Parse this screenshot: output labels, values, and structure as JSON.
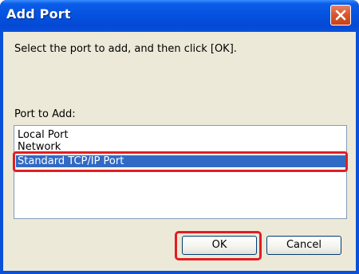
{
  "window": {
    "title": "Add Port"
  },
  "dialog": {
    "prompt": "Select the port to add, and then click [OK].",
    "list_label": "Port to Add:",
    "ports": [
      {
        "label": "Local Port",
        "selected": false
      },
      {
        "label": "Network",
        "selected": false
      },
      {
        "label": "Standard TCP/IP Port",
        "selected": true
      }
    ],
    "ok_label": "OK",
    "cancel_label": "Cancel"
  },
  "colors": {
    "titlebar": "#0553e0",
    "selection": "#316ac5",
    "annotation_red": "#e01e24",
    "client_bg": "#ece9d8"
  },
  "icons": {
    "close": "close-icon"
  }
}
